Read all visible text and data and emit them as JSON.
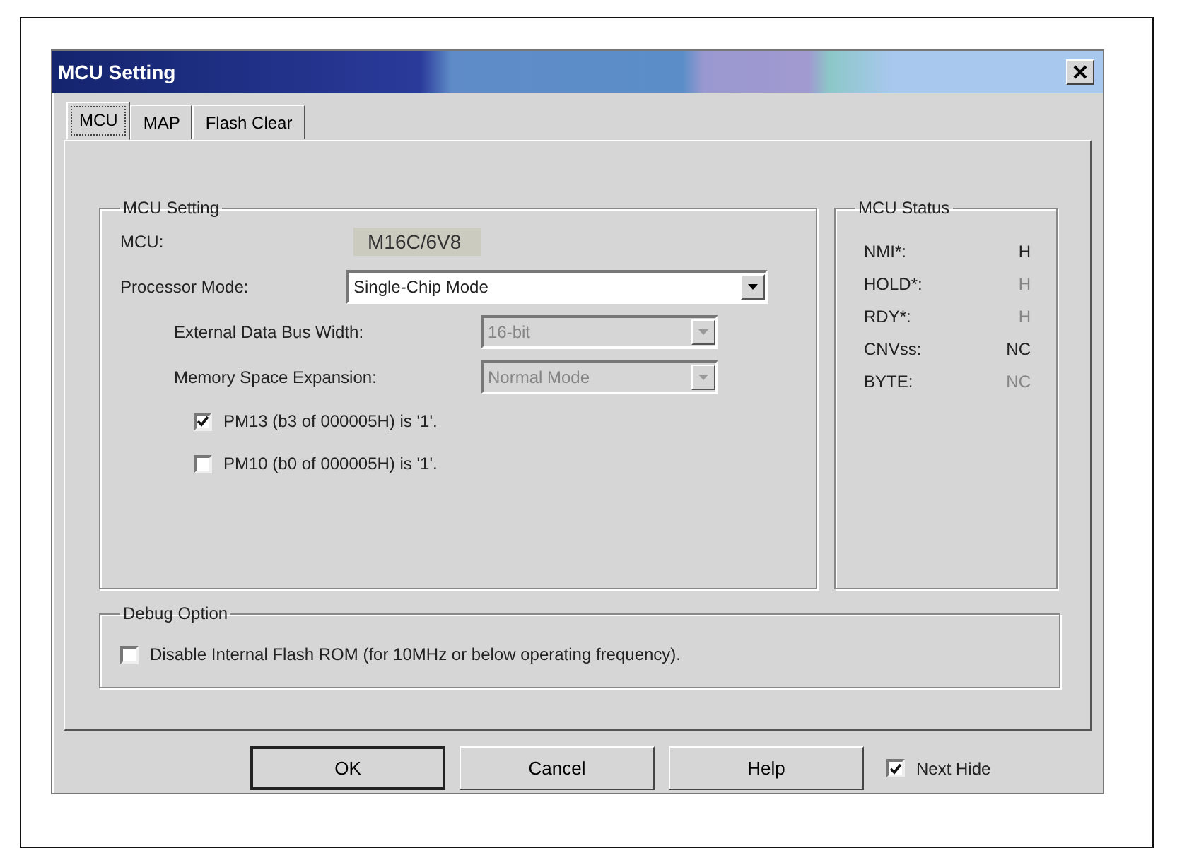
{
  "window": {
    "title": "MCU Setting"
  },
  "tabs": [
    {
      "label": "MCU",
      "selected": true
    },
    {
      "label": "MAP",
      "selected": false
    },
    {
      "label": "Flash Clear",
      "selected": false
    }
  ],
  "mcu_setting": {
    "title": "MCU Setting",
    "mcu_label": "MCU:",
    "mcu_value": "M16C/6V8",
    "fields": [
      {
        "label": "Processor Mode:",
        "value": "Single-Chip Mode",
        "disabled": false,
        "indented": false
      },
      {
        "label": "External Data Bus Width:",
        "value": "16-bit",
        "disabled": true,
        "indented": true
      },
      {
        "label": "Memory Space Expansion:",
        "value": "Normal Mode",
        "disabled": true,
        "indented": true
      }
    ],
    "options": [
      {
        "label": "PM13 (b3 of 000005H) is '1'.",
        "checked": true
      },
      {
        "label": "PM10 (b0 of 000005H) is '1'.",
        "checked": false
      }
    ]
  },
  "mcu_status": {
    "title": "MCU Status",
    "rows": [
      {
        "name": "NMI*:",
        "value": "H",
        "disabled": false
      },
      {
        "name": "HOLD*:",
        "value": "H",
        "disabled": true
      },
      {
        "name": "RDY*:",
        "value": "H",
        "disabled": true
      },
      {
        "name": "CNVss:",
        "value": "NC",
        "disabled": false
      },
      {
        "name": "BYTE:",
        "value": "NC",
        "disabled": true
      }
    ]
  },
  "debug_option": {
    "title": "Debug Option",
    "options": [
      {
        "label": "Disable Internal Flash ROM (for 10MHz or below operating frequency).",
        "checked": false
      }
    ]
  },
  "buttons": [
    {
      "label": "OK",
      "default": true
    },
    {
      "label": "Cancel",
      "default": false
    },
    {
      "label": "Help",
      "default": false
    }
  ],
  "next_hide": {
    "label": "Next Hide",
    "checked": true
  }
}
